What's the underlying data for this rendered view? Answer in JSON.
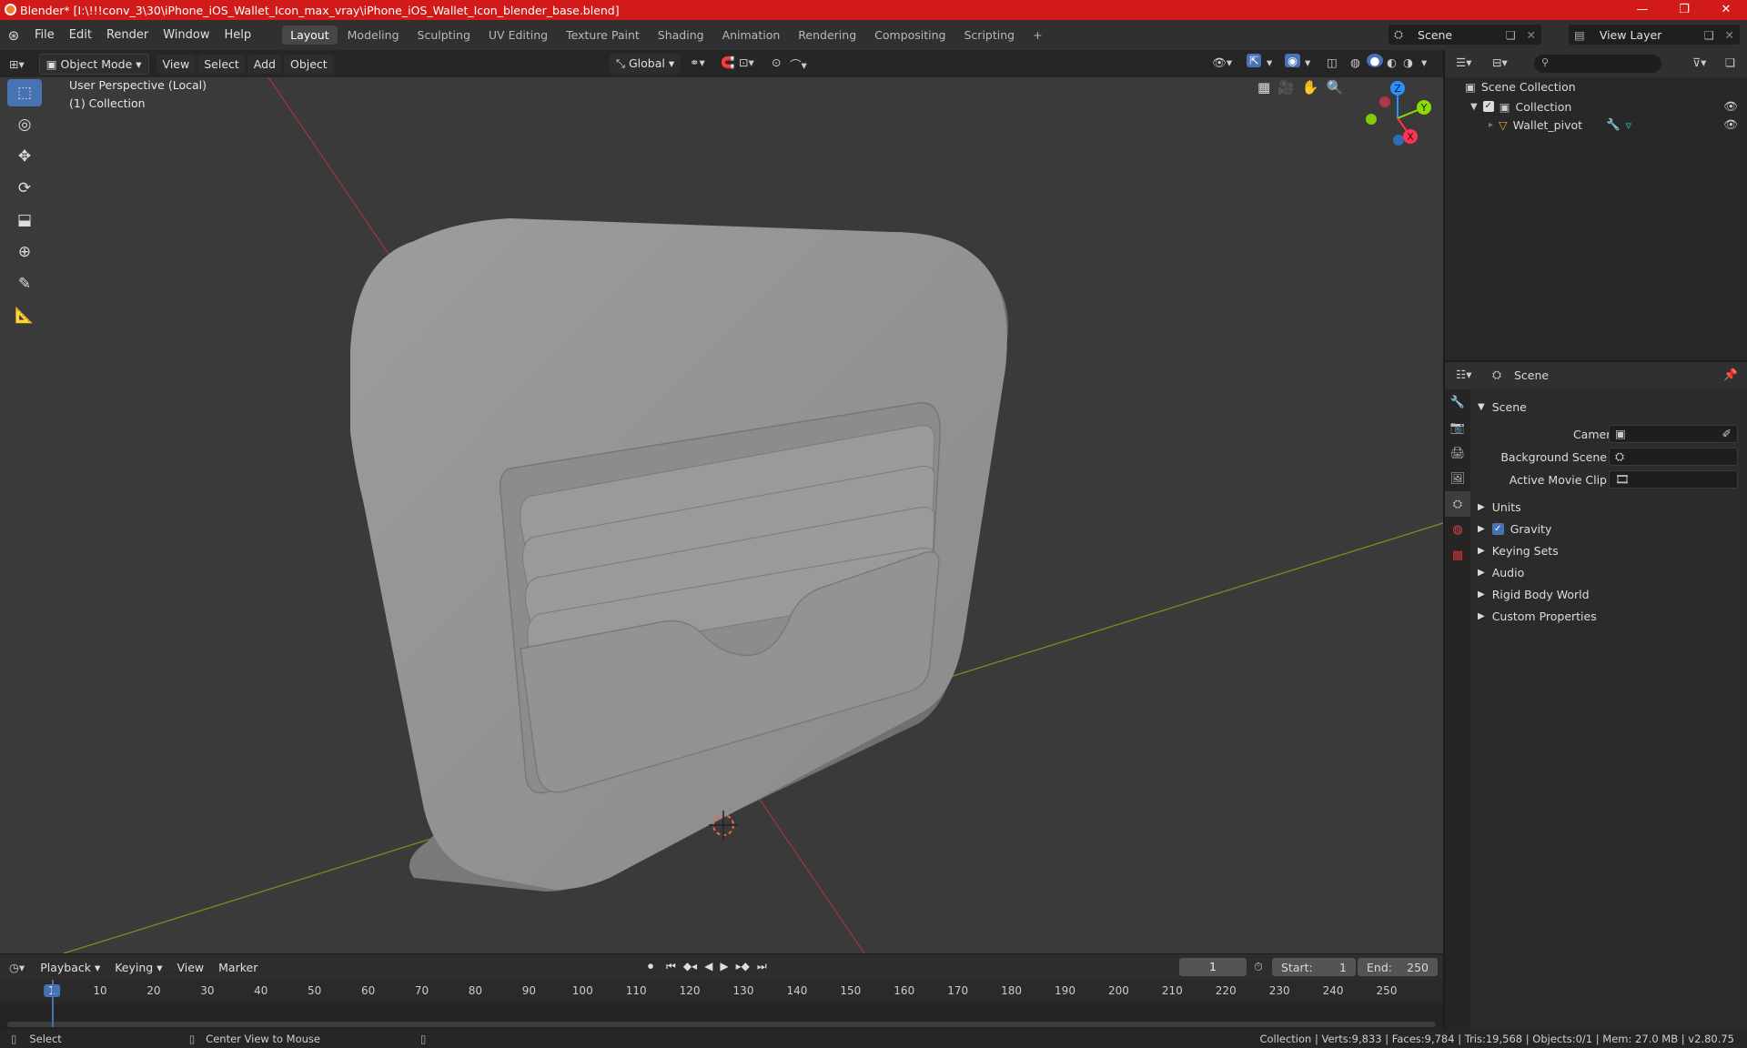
{
  "window": {
    "title": "Blender* [I:\\!!!conv_3\\30\\iPhone_iOS_Wallet_Icon_max_vray\\iPhone_iOS_Wallet_Icon_blender_base.blend]",
    "minimize": "—",
    "maximize": "❐",
    "close": "✕"
  },
  "menu": {
    "items": [
      "File",
      "Edit",
      "Render",
      "Window",
      "Help"
    ],
    "workspaces": [
      "Layout",
      "Modeling",
      "Sculpting",
      "UV Editing",
      "Texture Paint",
      "Shading",
      "Animation",
      "Rendering",
      "Compositing",
      "Scripting"
    ],
    "active_workspace": "Layout",
    "add_workspace": "+",
    "scene": "Scene",
    "view_layer": "View Layer"
  },
  "viewport_header": {
    "mode": "Object Mode",
    "menus": [
      "View",
      "Select",
      "Add",
      "Object"
    ],
    "transform_orientation": "Global"
  },
  "viewport": {
    "perspective_label": "User Perspective (Local)",
    "collection_label": "(1) Collection",
    "gizmo": {
      "x": "X",
      "y": "Y",
      "z": "Z"
    }
  },
  "outliner": {
    "scene_collection": "Scene Collection",
    "collection": "Collection",
    "object": "Wallet_pivot"
  },
  "properties": {
    "header_title": "Scene",
    "panel_title": "Scene",
    "camera_label": "Camera",
    "background_scene_label": "Background Scene",
    "active_movie_clip_label": "Active Movie Clip",
    "sections": [
      "Units",
      "Gravity",
      "Keying Sets",
      "Audio",
      "Rigid Body World",
      "Custom Properties"
    ],
    "gravity_checked": true
  },
  "timeline": {
    "menus": [
      "Playback",
      "Keying",
      "View",
      "Marker"
    ],
    "current_frame": "1",
    "start_label": "Start:",
    "start_value": "1",
    "end_label": "End:",
    "end_value": "250",
    "ticks": [
      "1",
      "10",
      "20",
      "30",
      "40",
      "50",
      "60",
      "70",
      "80",
      "90",
      "100",
      "110",
      "120",
      "130",
      "140",
      "150",
      "160",
      "170",
      "180",
      "190",
      "200",
      "210",
      "220",
      "230",
      "240",
      "250"
    ]
  },
  "statusbar": {
    "select": "Select",
    "center_view": "Center View to Mouse",
    "stats": "Collection | Verts:9,833 | Faces:9,784 | Tris:19,568 | Objects:0/1 | Mem: 27.0 MB | v2.80.75"
  },
  "colors": {
    "titlebar": "#d21a1a",
    "active_tool": "#4772b3",
    "x_axis": "#ff3352",
    "y_axis": "#8bdc00",
    "z_axis": "#2890ff"
  }
}
